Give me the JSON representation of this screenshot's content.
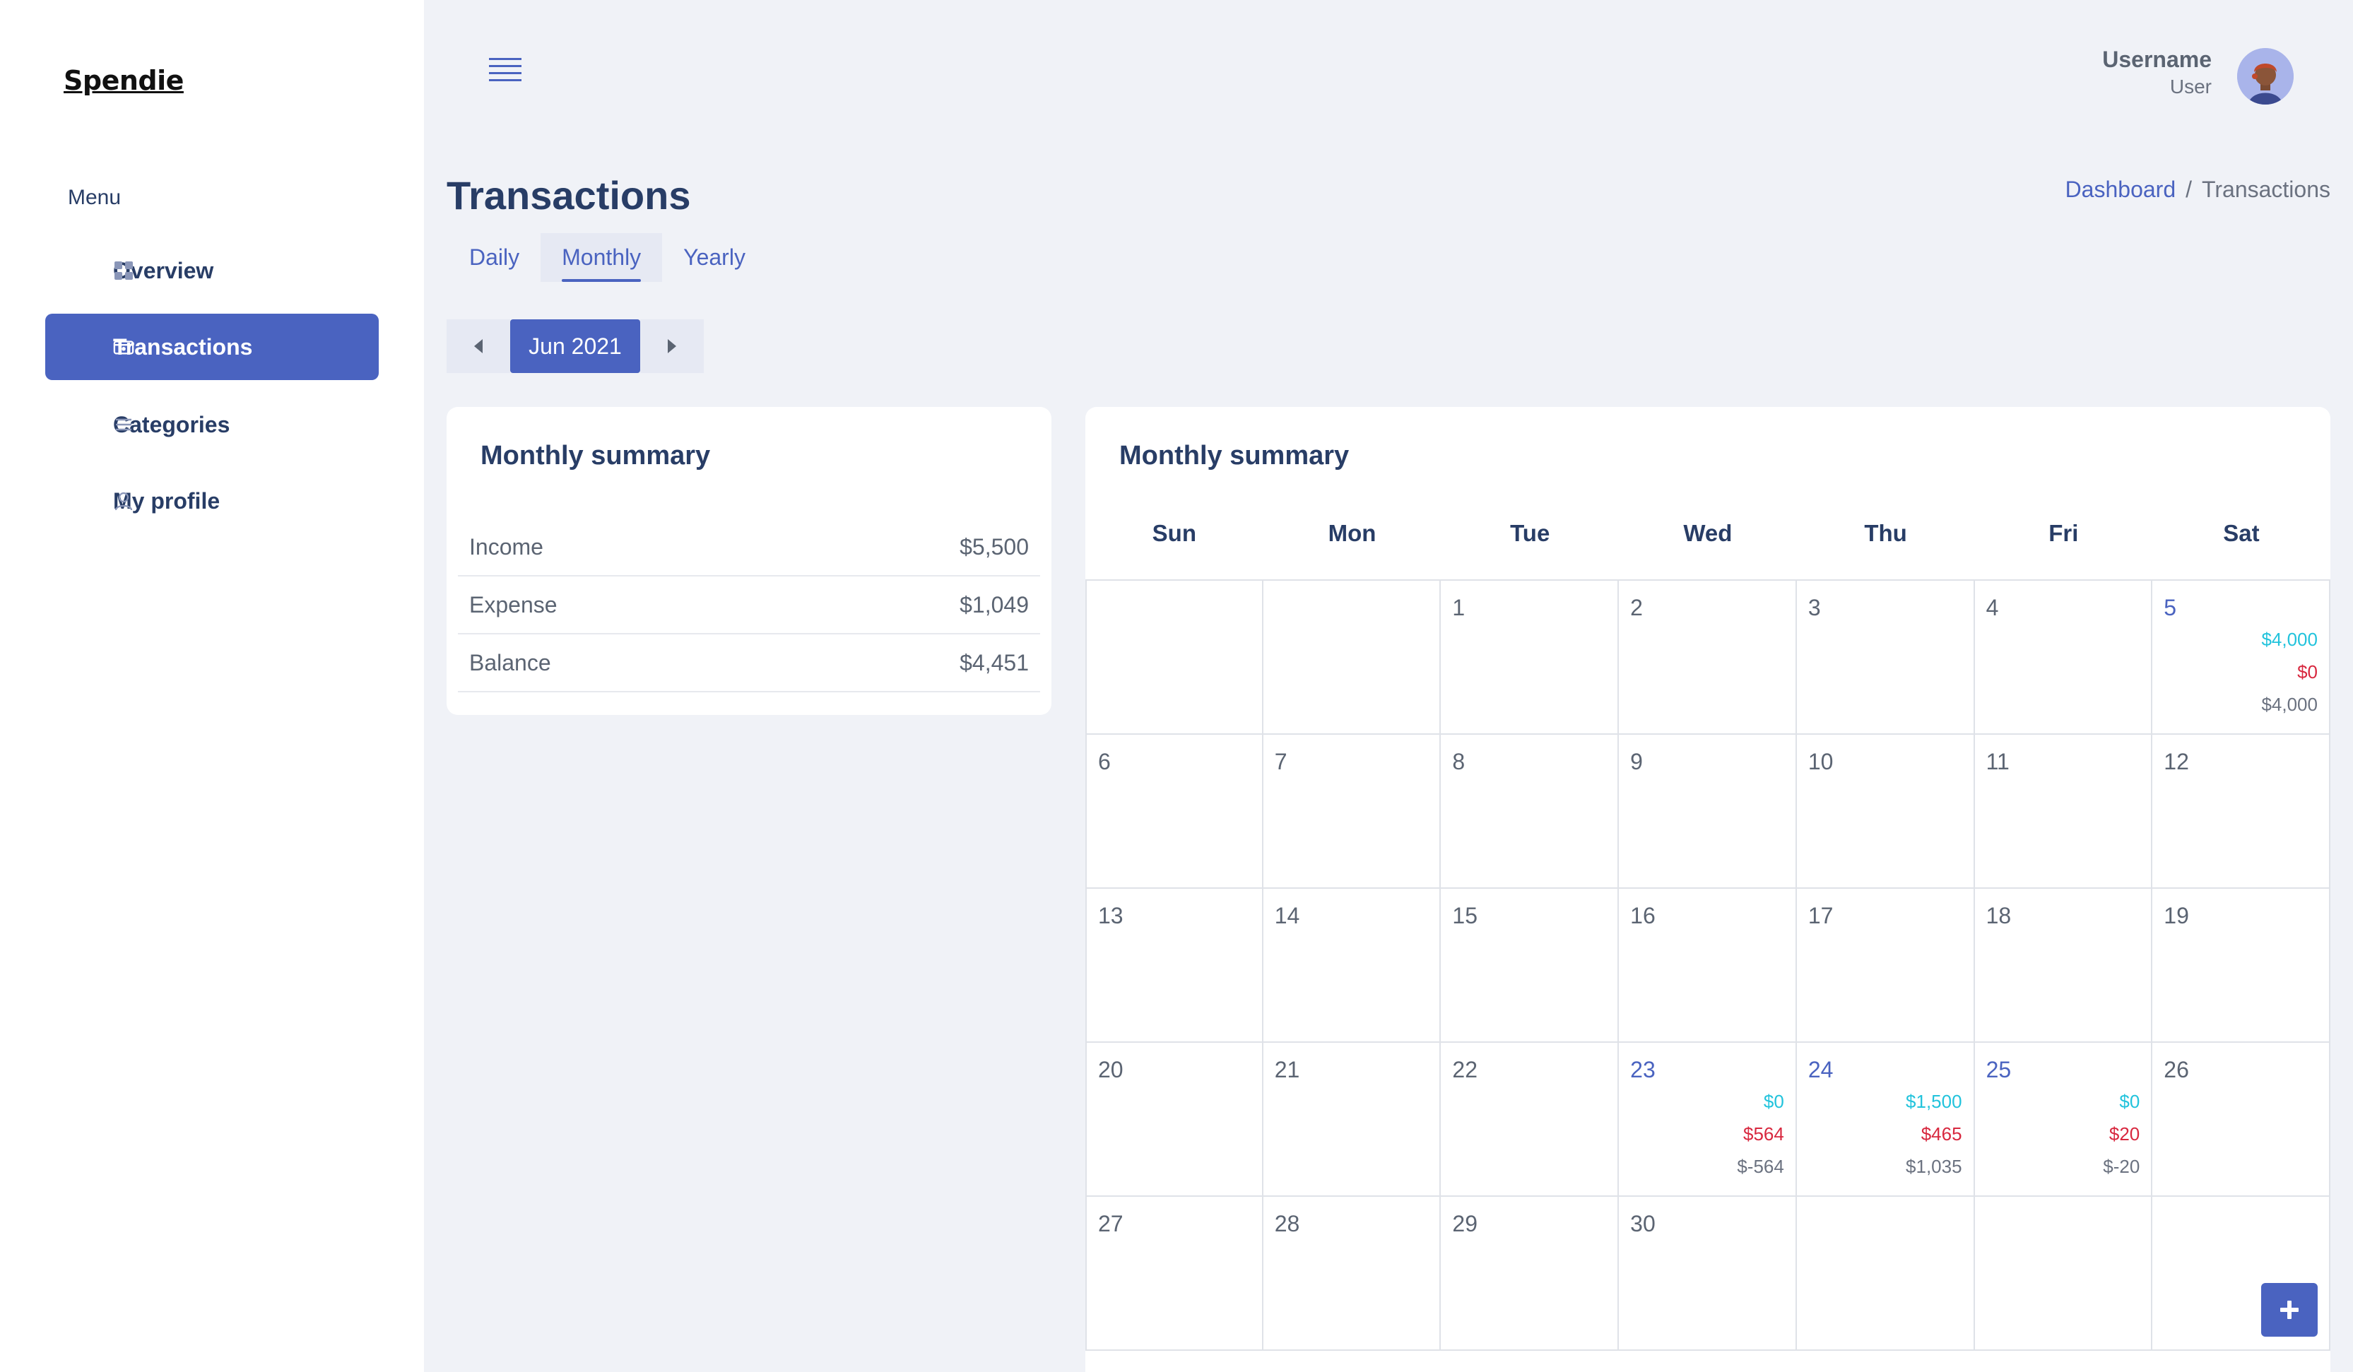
{
  "app": {
    "name": "Spendie"
  },
  "sidebar": {
    "menu_label": "Menu",
    "items": [
      {
        "label": "Overview",
        "icon": "grid-icon",
        "active": false
      },
      {
        "label": "Transactions",
        "icon": "wallet-icon",
        "active": true
      },
      {
        "label": "Categories",
        "icon": "list-icon",
        "active": false
      },
      {
        "label": "My profile",
        "icon": "user-icon",
        "active": false
      }
    ]
  },
  "topbar": {
    "menu_icon": "hamburger-icon",
    "user": {
      "name": "Username",
      "role": "User"
    }
  },
  "page": {
    "title": "Transactions",
    "breadcrumb": {
      "parent": "Dashboard",
      "separator": "/",
      "current": "Transactions"
    }
  },
  "tabs": [
    {
      "label": "Daily",
      "active": false
    },
    {
      "label": "Monthly",
      "active": true
    },
    {
      "label": "Yearly",
      "active": false
    }
  ],
  "period": {
    "label": "Jun 2021"
  },
  "summary": {
    "title": "Monthly summary",
    "rows": [
      {
        "label": "Income",
        "value": "$5,500"
      },
      {
        "label": "Expense",
        "value": "$1,049"
      },
      {
        "label": "Balance",
        "value": "$4,451"
      }
    ]
  },
  "calendar": {
    "title": "Monthly summary",
    "weekdays": [
      "Sun",
      "Mon",
      "Tue",
      "Wed",
      "Thu",
      "Fri",
      "Sat"
    ],
    "weeks": [
      [
        {
          "day": ""
        },
        {
          "day": ""
        },
        {
          "day": "1"
        },
        {
          "day": "2"
        },
        {
          "day": "3"
        },
        {
          "day": "4"
        },
        {
          "day": "5",
          "income": "$4,000",
          "expense": "$0",
          "balance": "$4,000"
        }
      ],
      [
        {
          "day": "6"
        },
        {
          "day": "7"
        },
        {
          "day": "8"
        },
        {
          "day": "9"
        },
        {
          "day": "10"
        },
        {
          "day": "11"
        },
        {
          "day": "12"
        }
      ],
      [
        {
          "day": "13"
        },
        {
          "day": "14"
        },
        {
          "day": "15"
        },
        {
          "day": "16"
        },
        {
          "day": "17"
        },
        {
          "day": "18"
        },
        {
          "day": "19"
        }
      ],
      [
        {
          "day": "20"
        },
        {
          "day": "21"
        },
        {
          "day": "22"
        },
        {
          "day": "23",
          "income": "$0",
          "expense": "$564",
          "balance": "$-564"
        },
        {
          "day": "24",
          "income": "$1,500",
          "expense": "$465",
          "balance": "$1,035"
        },
        {
          "day": "25",
          "income": "$0",
          "expense": "$20",
          "balance": "$-20"
        },
        {
          "day": "26"
        }
      ],
      [
        {
          "day": "27"
        },
        {
          "day": "28"
        },
        {
          "day": "29"
        },
        {
          "day": "30"
        },
        {
          "day": ""
        },
        {
          "day": ""
        },
        {
          "day": ""
        }
      ]
    ]
  },
  "fab": {
    "icon": "plus-icon"
  },
  "colors": {
    "accent": "#4a63c0",
    "income": "#22c3dc",
    "expense": "#d8283f",
    "balance": "#6b7280",
    "background": "#f0f2f7"
  }
}
